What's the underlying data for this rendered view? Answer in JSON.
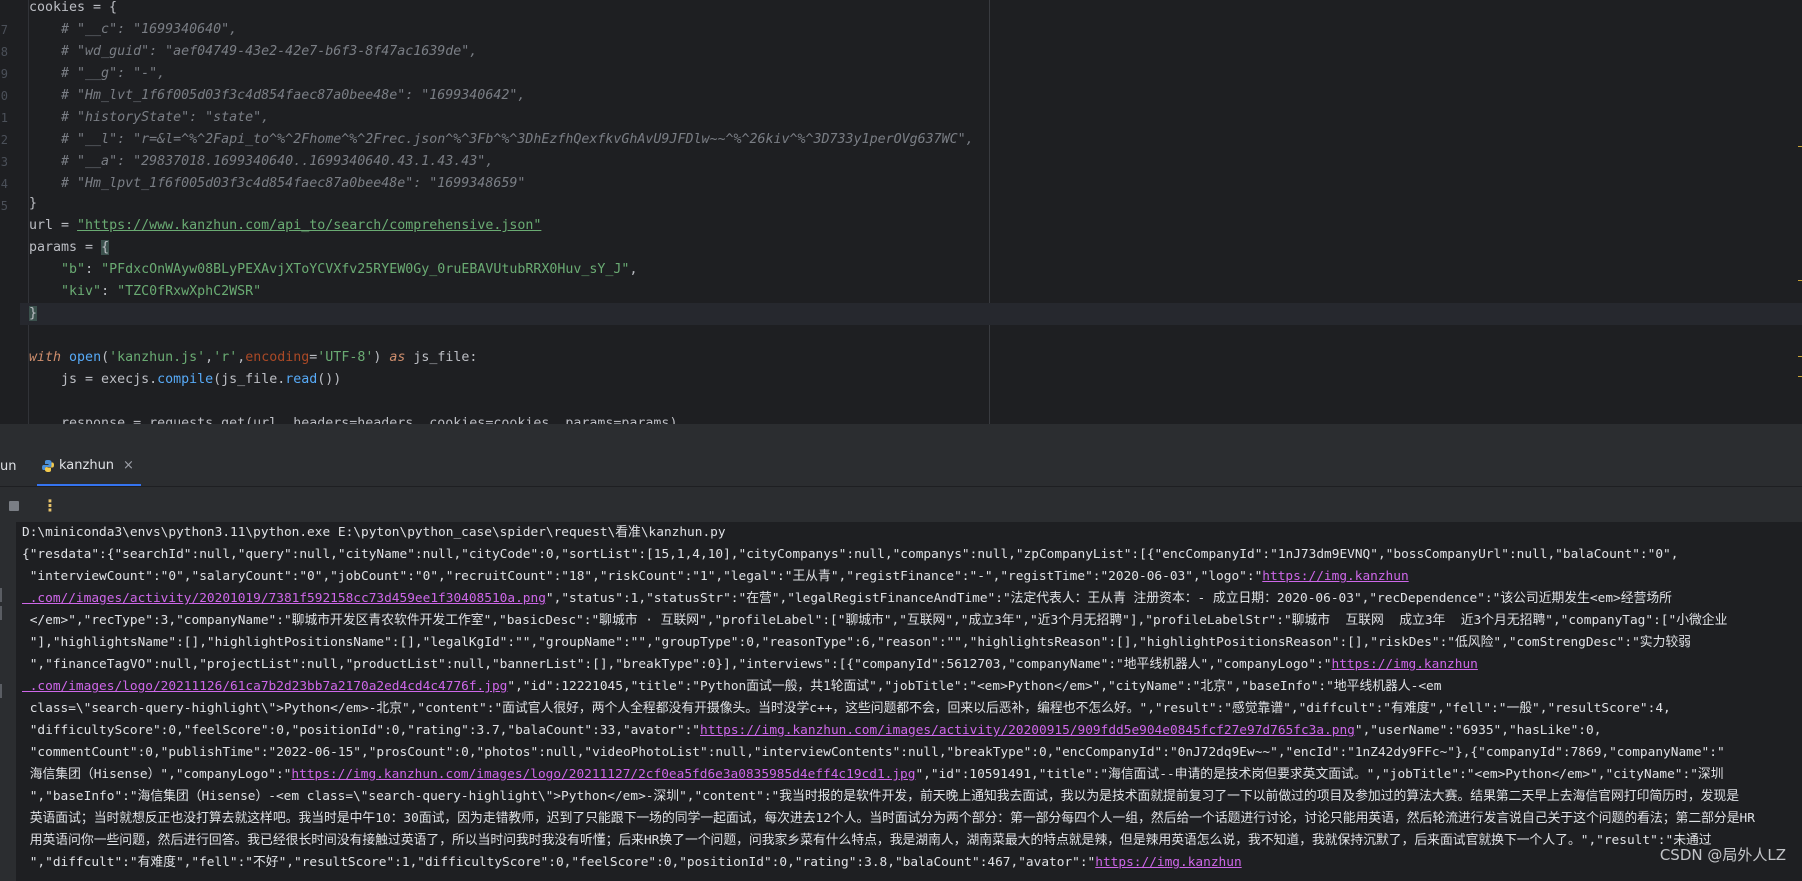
{
  "editor": {
    "line_numbers": [
      "",
      "7",
      "8",
      "9",
      "0",
      "1",
      "2",
      "3",
      "4",
      "5",
      "",
      "",
      "",
      "",
      "",
      "",
      "",
      ""
    ],
    "cookies_open": "cookies = {",
    "cookie_comments": [
      "# \"__c\": \"1699340640\",",
      "# \"wd_guid\": \"aef04749-43e2-42e7-b6f3-8f47ac1639de\",",
      "# \"__g\": \"-\",",
      "# \"Hm_lvt_1f6f005d03f3c4d854faec87a0bee48e\": \"1699340642\",",
      "# \"historyState\": \"state\",",
      "# \"__l\": \"r=&l=^%^2Fapi_to^%^2Fhome^%^2Frec.json^%^3Fb^%^3DhEzfhQexfkvGhAvU9JFDlw~~^%^26kiv^%^3D733y1perOVg637WC\",",
      "# \"__a\": \"29837018.1699340640..1699340640.43.1.43.43\",",
      "# \"Hm_lpvt_1f6f005d03f3c4d854faec87a0bee48e\": \"1699348659\""
    ],
    "close_brace": "}",
    "url_prefix": "url = ",
    "url_value": "\"https://www.kanzhun.com/api_to/search/comprehensive.json\"",
    "params_prefix": "params = ",
    "params_open": "{",
    "param_b_key": "\"b\"",
    "param_b_value": "\"PFdxcOnWAyw08BLyPEXAvjXToYCVXfv25RYEW0Gy_0ruEBAVUtubRRX0Huv_sY_J\"",
    "param_kiv_key": "\"kiv\"",
    "param_kiv_value": "\"TZC0fRxwXphC2WSR\"",
    "params_close": "}",
    "with_kw": "with",
    "open_fn": "open",
    "open_args_1": "'kanzhun.js'",
    "open_args_2": "'r'",
    "encoding_kw": "encoding",
    "encoding_val": "'UTF-8'",
    "as_kw": "as",
    "with_tail": " js_file:",
    "js_line_prefix": "js = execjs.",
    "compile_fn": "compile",
    "js_line_mid": "(js_file.",
    "read_fn": "read",
    "js_line_end": "())",
    "cut_line": "response = requests.get(url, headers=headers, cookies=cookies, params=params)"
  },
  "run_panel": {
    "prev_tab_label": "un",
    "active_tab_label": "kanzhun",
    "close_glyph": "×",
    "more_glyph": "⋮"
  },
  "console": {
    "command": "D:\\miniconda3\\envs\\python3.11\\python.exe E:\\pyton\\python_case\\spider\\request\\看准\\kanzhun.py",
    "lines": [
      [
        {
          "t": "{\"resdata\":{\"searchId\":null,\"query\":null,\"cityName\":null,\"cityCode\":0,\"sortList\":[15,1,4,10],\"cityCompanys\":null,\"companys\":null,\"zpCompanyList\":[{\"encCompanyId\":\"1nJ73dm9EVNQ\",\"bossCompanyUrl\":null,\"balaCount\":\"0\","
        }
      ],
      [
        {
          "t": " \"interviewCount\":\"0\",\"salaryCount\":\"0\",\"jobCount\":\"0\",\"recruitCount\":\"18\",\"riskCount\":\"1\",\"legal\":\"王从青\",\"registFinance\":\"-\",\"registTime\":\"2020-06-03\",\"logo\":\""
        },
        {
          "a": "https://img.kanzhun"
        }
      ],
      [
        {
          "a": " .com//images/activity/20201019/7381f592158cc73d459ee1f30408510a.png"
        },
        {
          "t": "\",\"status\":1,\"statusStr\":\"在营\",\"legalRegistFinanceAndTime\":\"法定代表人：王从青 注册资本：- 成立日期：2020-06-03\",\"recDependence\":\"该公司近期发生<em>经营场所"
        }
      ],
      [
        {
          "t": " </em>\",\"recType\":3,\"companyName\":\"聊城市开发区青农软件开发工作室\",\"basicDesc\":\"聊城市 · 互联网\",\"profileLabel\":[\"聊城市\",\"互联网\",\"成立3年\",\"近3个月无招聘\"],\"profileLabelStr\":\"聊城市  互联网  成立3年  近3个月无招聘\",\"companyTag\":[\"小微企业"
        }
      ],
      [
        {
          "t": " \"],\"highlightsName\":[],\"highlightPositionsName\":[],\"legalKgId\":\"\",\"groupName\":\"\",\"groupType\":0,\"reasonType\":6,\"reason\":\"\",\"highlightsReason\":[],\"highlightPositionsReason\":[],\"riskDes\":\"低风险\",\"comStrengDesc\":\"实力较弱"
        }
      ],
      [
        {
          "t": " \",\"financeTagVO\":null,\"projectList\":null,\"productList\":null,\"bannerList\":[],\"breakType\":0}],\"interviews\":[{\"companyId\":5612703,\"companyName\":\"地平线机器人\",\"companyLogo\":\""
        },
        {
          "a": "https://img.kanzhun"
        }
      ],
      [
        {
          "a": " .com/images/logo/20211126/61ca7b2d23bb7a2170a2ed4cd4c4776f.jpg"
        },
        {
          "t": "\",\"id\":12221045,\"title\":\"Python面试一般，共1轮面试\",\"jobTitle\":\"<em>Python</em>\",\"cityName\":\"北京\",\"baseInfo\":\"地平线机器人-<em"
        }
      ],
      [
        {
          "t": " class=\\\"search-query-highlight\\\">Python</em>-北京\",\"content\":\"面试官人很好，两个人全程都没有开摄像头。当时没学c++，这些问题都不会，回来以后恶补，编程也不怎么好。\",\"result\":\"感觉靠谱\",\"diffcult\":\"有难度\",\"fell\":\"一般\",\"resultScore\":4,"
        }
      ],
      [
        {
          "t": " \"difficultyScore\":0,\"feelScore\":0,\"positionId\":0,\"rating\":3.7,\"balaCount\":33,\"avator\":\""
        },
        {
          "a": "https://img.kanzhun.com/images/activity/20200915/909fdd5e904e0845fcf27e97d765fc3a.png"
        },
        {
          "t": "\",\"userName\":\"6935\",\"hasLike\":0,"
        }
      ],
      [
        {
          "t": " \"commentCount\":0,\"publishTime\":\"2022-06-15\",\"prosCount\":0,\"photos\":null,\"videoPhotoList\":null,\"interviewContents\":null,\"breakType\":0,\"encCompanyId\":\"0nJ72dq9Ew~~\",\"encId\":\"1nZ42dy9FFc~\"},{\"companyId\":7869,\"companyName\":\""
        }
      ],
      [
        {
          "t": " 海信集团（Hisense）\",\"companyLogo\":\""
        },
        {
          "a": "https://img.kanzhun.com/images/logo/20211127/2cf0ea5fd6e3a0835985d4eff4c19cd1.jpg"
        },
        {
          "t": "\",\"id\":10591491,\"title\":\"海信面试--申请的是技术岗但要求英文面试。\",\"jobTitle\":\"<em>Python</em>\",\"cityName\":\"深圳"
        }
      ],
      [
        {
          "t": " \",\"baseInfo\":\"海信集团（Hisense）-<em class=\\\"search-query-highlight\\\">Python</em>-深圳\",\"content\":\"我当时报的是软件开发，前天晚上通知我去面试，我以为是技术面就提前复习了一下以前做过的项目及参加过的算法大赛。结果第二天早上去海信官网打印简历时，发现是"
        }
      ],
      [
        {
          "t": " 英语面试；当时就想反正也没打算去就这样吧。我当时是中午10：30面试，因为走错教师，迟到了只能跟下一场的同学一起面试，每次进去12个人。当时面试分为两个部分：第一部分每四个人一组，然后给一个话题进行讨论，讨论只能用英语，然后轮流进行发言说自己关于这个问题的看法；第二部分是HR"
        }
      ],
      [
        {
          "t": " 用英语问你一些问题，然后进行回答。我已经很长时间没有接触过英语了，所以当时问我时我没有听懂；后来HR换了一个问题，问我家乡菜有什么特点，我是湖南人，湖南菜最大的特点就是辣，但是辣用英语怎么说，我不知道，我就保持沉默了，后来面试官就换下一个人了。\",\"result\":\"未通过"
        }
      ],
      [
        {
          "t": " \",\"diffcult\":\"有难度\",\"fell\":\"不好\",\"resultScore\":1,\"difficultyScore\":0,\"feelScore\":0,\"positionId\":0,\"rating\":3.8,\"balaCount\":467,\"avator\":\""
        },
        {
          "a": "https://img.kanzhun"
        }
      ]
    ]
  },
  "watermark": "CSDN @局外人LZ"
}
